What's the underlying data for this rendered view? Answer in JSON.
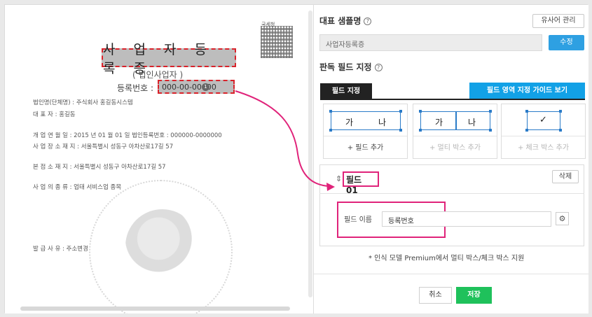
{
  "document": {
    "title": "사 업 자 등 록 증",
    "subtitle": "( 법인사업자 )",
    "reg_label": "등록번호 :",
    "reg_value": "000-00-00000",
    "qr_caption": "국세청",
    "rows": [
      "법인명(단체명) :  주식회사 홍길동시스템",
      "대          표          자 :  홍길동",
      "개 업 연 월 일 :  2015 년 01 월 01 일       법인등록번호 :  000000-0000000",
      "사 업 장  소 재 지 :  서울특별시 성동구 아차산로17길 57",
      "본  점  소  재  지 :  서울특별시 성동구 아차산로17길 57",
      "사 업 의  종 류 :   업태   서비스업                        종목",
      "발    급    사    유 :  주소변경"
    ]
  },
  "panel": {
    "sample_heading": "대표 샘플명",
    "manage_similar": "유사어 관리",
    "sample_value": "사업자등록증",
    "edit_label": "수정",
    "field_heading": "판독 필드 지정",
    "tab_field": "필드 지정",
    "guide_button": "필드 영역 지정 가이드 보기",
    "cards": [
      {
        "h1": "가",
        "h2": "나",
        "add": "+ 필드 추가"
      },
      {
        "h1": "가",
        "h2": "나",
        "add": "+ 멀티 박스 추가"
      },
      {
        "mark": "✓",
        "add": "+ 체크 박스 추가"
      }
    ],
    "field_title": "필드 01",
    "delete_label": "삭제",
    "field_name_label": "필드 이름",
    "field_name_value": "등록번호",
    "note": "* 인식 모델 Premium에서 멀티 박스/체크 박스 지원",
    "cancel_label": "취소",
    "save_label": "저장"
  }
}
